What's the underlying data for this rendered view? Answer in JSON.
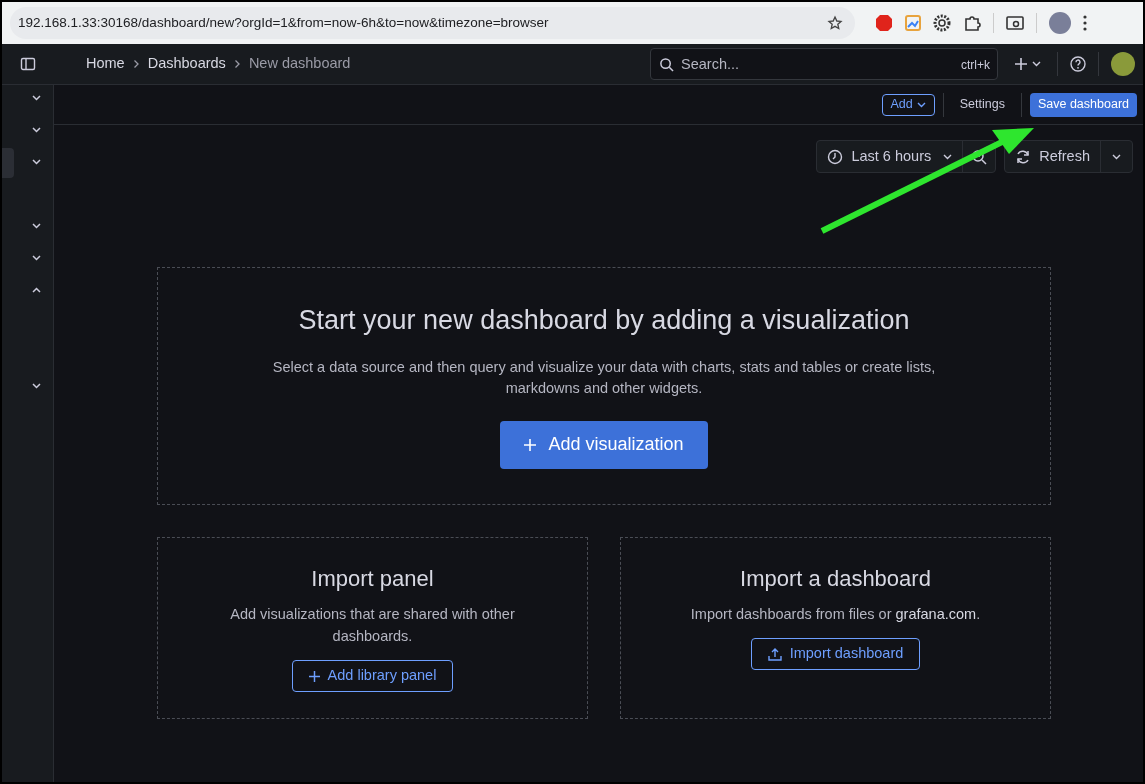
{
  "browser": {
    "url": "192.168.1.33:30168/dashboard/new?orgId=1&from=now-6h&to=now&timezone=browser"
  },
  "breadcrumbs": [
    "Home",
    "Dashboards",
    "New dashboard"
  ],
  "search": {
    "placeholder": "Search...",
    "shortcut": "ctrl+k"
  },
  "toolbar": {
    "add": "Add",
    "settings": "Settings",
    "save": "Save dashboard"
  },
  "time_picker": {
    "range": "Last 6 hours",
    "refresh": "Refresh"
  },
  "sidebar_toggles": [
    {
      "expanded": false
    },
    {
      "expanded": false
    },
    {
      "expanded": false
    },
    {
      "expanded": false
    },
    {
      "expanded": false
    },
    {
      "expanded": true
    },
    {
      "expanded": false
    }
  ],
  "empty_state": {
    "title": "Start your new dashboard by adding a visualization",
    "text": "Select a data source and then query and visualize your data with charts, stats and tables or create lists, markdowns and other widgets.",
    "button": "Add visualization"
  },
  "cards": [
    {
      "title": "Import panel",
      "text": "Add visualizations that are shared with other dashboards.",
      "button": "Add library panel",
      "kind": "library"
    },
    {
      "title": "Import a dashboard",
      "text": "Import dashboards from files or **grafana.com**.",
      "button": "Import dashboard",
      "kind": "import"
    }
  ]
}
